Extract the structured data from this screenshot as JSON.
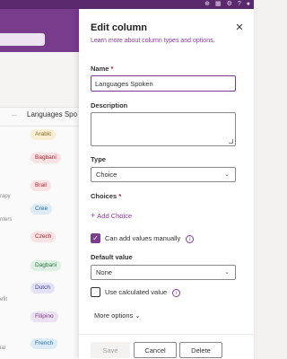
{
  "panel": {
    "title": "Edit column",
    "learn_more_link": "Learn more about column types and options.",
    "name_label": "Name",
    "required_mark": "*",
    "name_value": "Languages Spoken",
    "description_label": "Description",
    "description_value": "",
    "type_label": "Type",
    "type_value": "Choice",
    "choices_label": "Choices",
    "add_choice": "Add Choice",
    "can_add_manually": "Can add values manually",
    "can_add_manually_checked": true,
    "default_value_label": "Default value",
    "default_value": "None",
    "use_calculated": "Use calculated value",
    "use_calculated_checked": false,
    "more_options": "More options",
    "save": "Save",
    "cancel": "Cancel",
    "delete": "Delete"
  },
  "background": {
    "column_header": "Languages Spo",
    "header_dots": "...",
    "rows": [
      {
        "side": "",
        "pill": "Arabic"
      },
      {
        "side": "",
        "pill": "Bagbani"
      },
      {
        "side": "rapy",
        "pill": "Brail"
      },
      {
        "side": "nters",
        "pill": "Cree"
      },
      {
        "side": "",
        "pill": "Czech"
      },
      {
        "side": "",
        "pill": "Dagbani"
      },
      {
        "side": "efit",
        "pill": "Dutch"
      },
      {
        "side": "",
        "pill": "Filipino"
      },
      {
        "side": "ial",
        "pill": "French"
      }
    ]
  },
  "icons": {
    "close": "close-icon",
    "chevron": "chevron-down-icon",
    "info": "info-icon",
    "plus": "plus-icon"
  },
  "colors": {
    "accent": "#7c3d8f",
    "link": "#8a3a9f",
    "topbar": "#5b2a6e"
  }
}
